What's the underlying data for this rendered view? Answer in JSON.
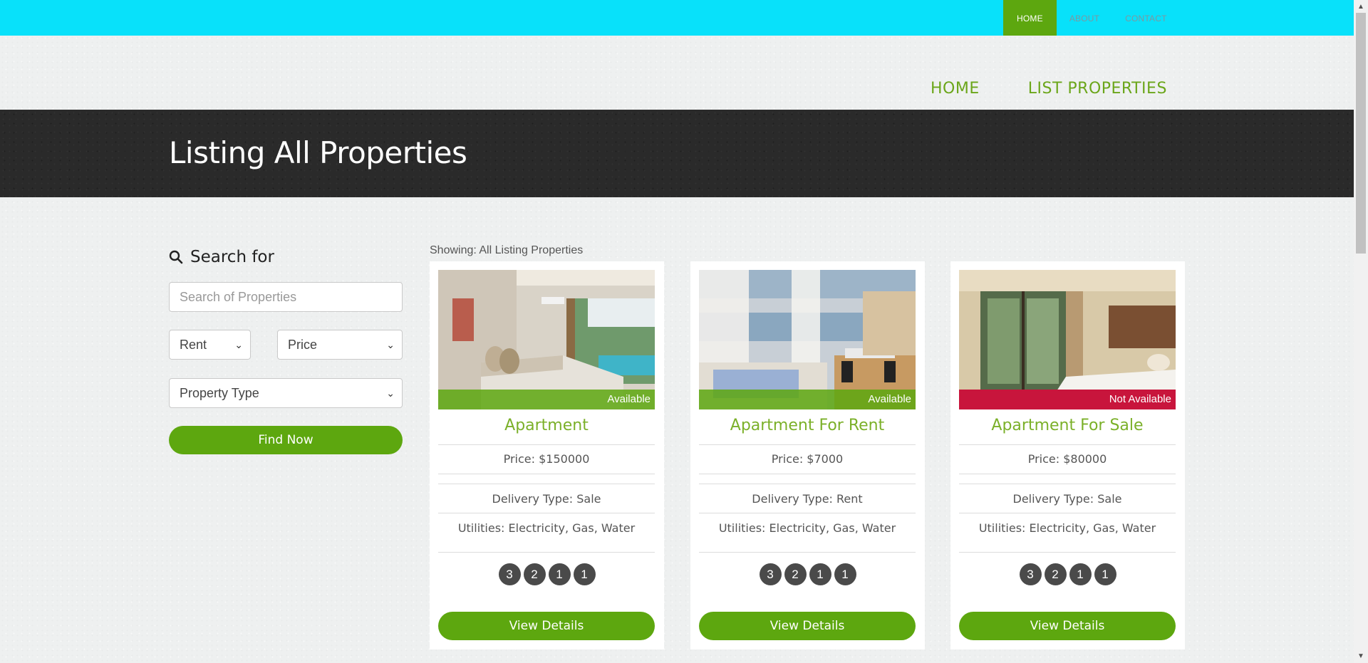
{
  "top_nav": {
    "items": [
      {
        "label": "HOME",
        "active": true
      },
      {
        "label": "ABOUT",
        "active": false
      },
      {
        "label": "CONTACT",
        "active": false
      }
    ]
  },
  "main_nav": {
    "items": [
      {
        "label": "HOME"
      },
      {
        "label": "LIST PROPERTIES"
      }
    ]
  },
  "banner": {
    "title": "Listing All Properties"
  },
  "search": {
    "heading": "Search for",
    "icon": "search-icon",
    "placeholder": "Search of Properties",
    "delivery_select": "Rent",
    "price_select": "Price",
    "type_select": "Property Type",
    "button": "Find Now"
  },
  "listing": {
    "showing_text": "Showing: All Listing Properties",
    "cards": [
      {
        "status": "Available",
        "title": "Apartment",
        "price": "Price: $150000",
        "delivery": "Delivery Type: Sale",
        "utilities": "Utilities: Electricity, Gas, Water",
        "badges": [
          "3",
          "2",
          "1",
          "1"
        ],
        "button": "View Details"
      },
      {
        "status": "Available",
        "title": "Apartment For Rent",
        "price": "Price: $7000",
        "delivery": "Delivery Type: Rent",
        "utilities": "Utilities: Electricity, Gas, Water",
        "badges": [
          "3",
          "2",
          "1",
          "1"
        ],
        "button": "View Details"
      },
      {
        "status": "Not Available",
        "title": "Apartment For Sale",
        "price": "Price: $80000",
        "delivery": "Delivery Type: Sale",
        "utilities": "Utilities: Electricity, Gas, Water",
        "badges": [
          "3",
          "2",
          "1",
          "1"
        ],
        "button": "View Details"
      }
    ]
  },
  "colors": {
    "topbar": "#08e1fa",
    "accent_green": "#5da70f",
    "title_green": "#7bb029",
    "not_available_red": "#c8153c",
    "banner_dark": "#2a2a2a"
  }
}
